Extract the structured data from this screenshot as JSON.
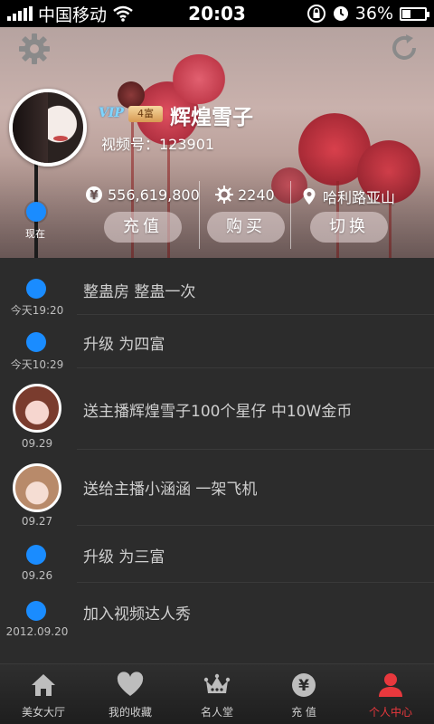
{
  "status_bar": {
    "carrier": "中国移动",
    "time": "20:03",
    "battery": "36%",
    "battery_level": 0.36
  },
  "profile": {
    "vip_label": "VIP",
    "rank_badge": "4富",
    "username": "辉煌雪子",
    "video_id": "视频号：123901",
    "coins": "556,619,800",
    "points": "2240",
    "location": "哈利路亚山",
    "now_label": "现在"
  },
  "actions": {
    "recharge": "充值",
    "buy": "购买",
    "switch": "切换"
  },
  "feed": [
    {
      "text": "整蛊房 整蛊一次",
      "date": "今天19:20",
      "type": "dot"
    },
    {
      "text": "升级 为四富",
      "date": "今天10:29",
      "type": "dot"
    },
    {
      "text": "送主播辉煌雪子100个星仔 中10W金币",
      "date": "09.29",
      "type": "avatar"
    },
    {
      "text": "送给主播小涵涵 一架飞机",
      "date": "09.27",
      "type": "avatar"
    },
    {
      "text": "升级 为三富",
      "date": "09.26",
      "type": "dot"
    },
    {
      "text": "加入视频达人秀",
      "date": "2012.09.20",
      "type": "dot"
    }
  ],
  "tabs": [
    {
      "label": "美女大厅",
      "icon": "home-icon"
    },
    {
      "label": "我的收藏",
      "icon": "heart-icon"
    },
    {
      "label": "名人堂",
      "icon": "crown-icon"
    },
    {
      "label": "充 值",
      "icon": "yen-icon"
    },
    {
      "label": "个人中心",
      "icon": "person-icon"
    }
  ],
  "colors": {
    "accent": "#1a8cff",
    "active_tab": "#e8383d",
    "feed_bg": "#2c2c2c"
  }
}
